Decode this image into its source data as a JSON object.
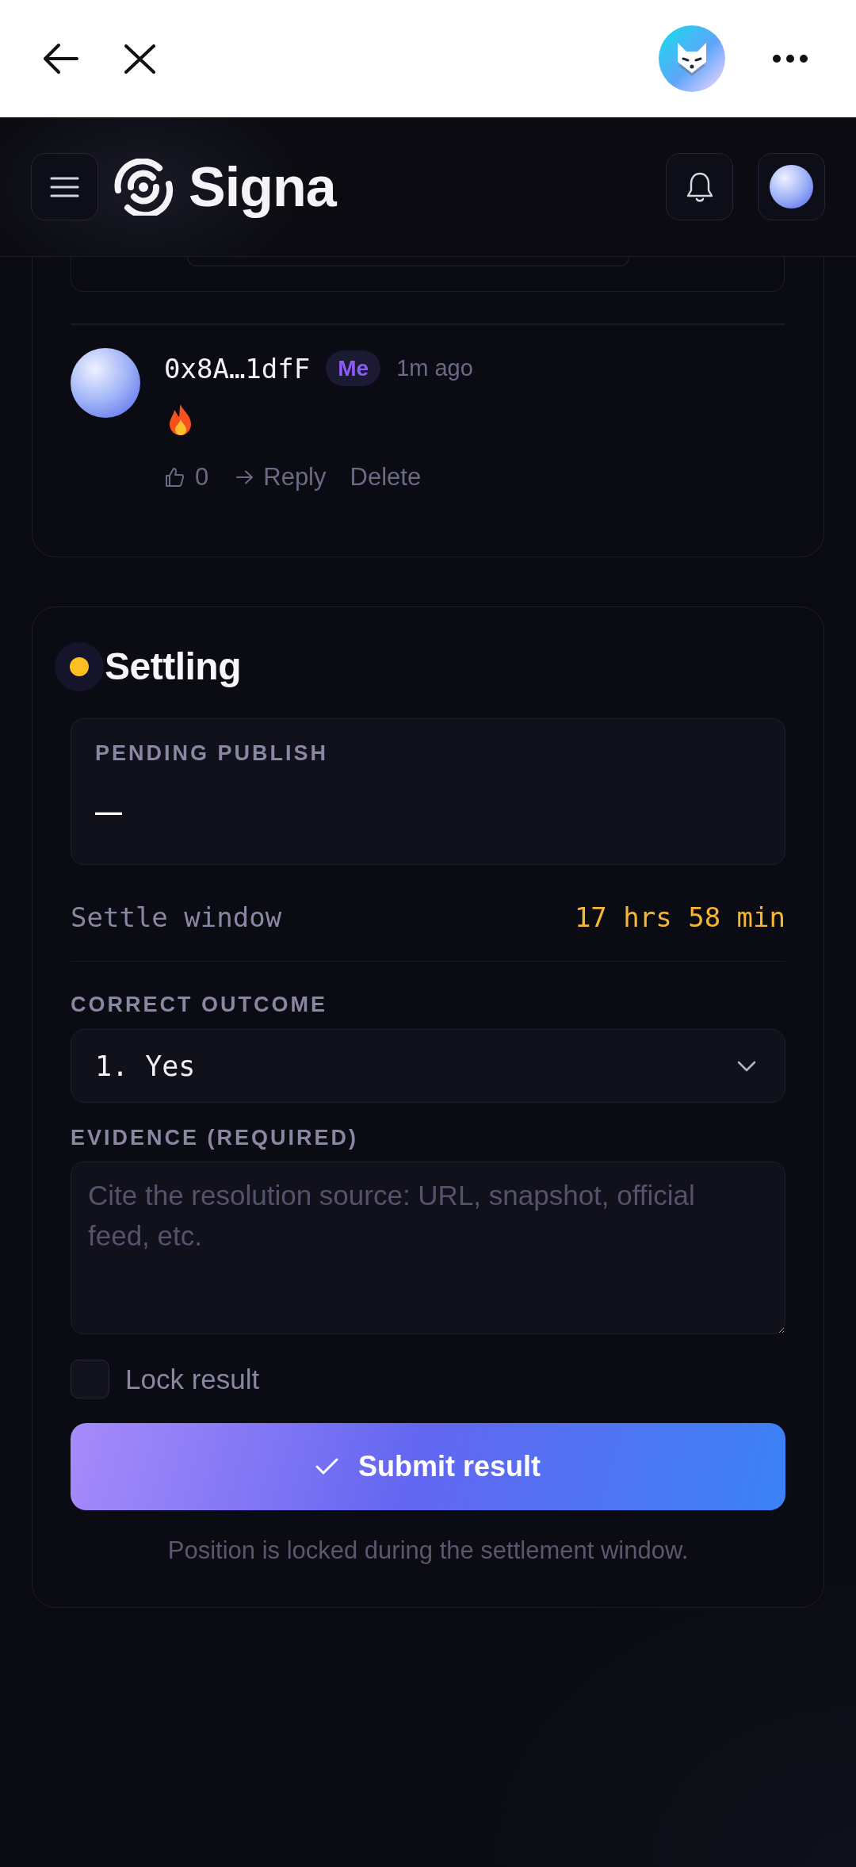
{
  "header": {
    "brand": "Signa"
  },
  "comments": [
    {
      "author": "0x8A…1dfF",
      "badge": "Me",
      "time": "1m ago",
      "likes": "0",
      "reply": "Reply",
      "delete": "Delete"
    }
  ],
  "settlement": {
    "title": "Settling",
    "pending": {
      "label": "PENDING PUBLISH",
      "value": "—"
    },
    "settle_window": {
      "label": "Settle window",
      "value": "17 hrs 58 min"
    },
    "outcome": {
      "label": "CORRECT OUTCOME",
      "value": "1. Yes"
    },
    "evidence": {
      "label": "EVIDENCE (REQUIRED)",
      "placeholder": "Cite the resolution source: URL, snapshot, official feed, etc."
    },
    "lock": {
      "label": "Lock result",
      "checked": false
    },
    "submit": "Submit result",
    "note": "Position is locked during the settlement window."
  }
}
